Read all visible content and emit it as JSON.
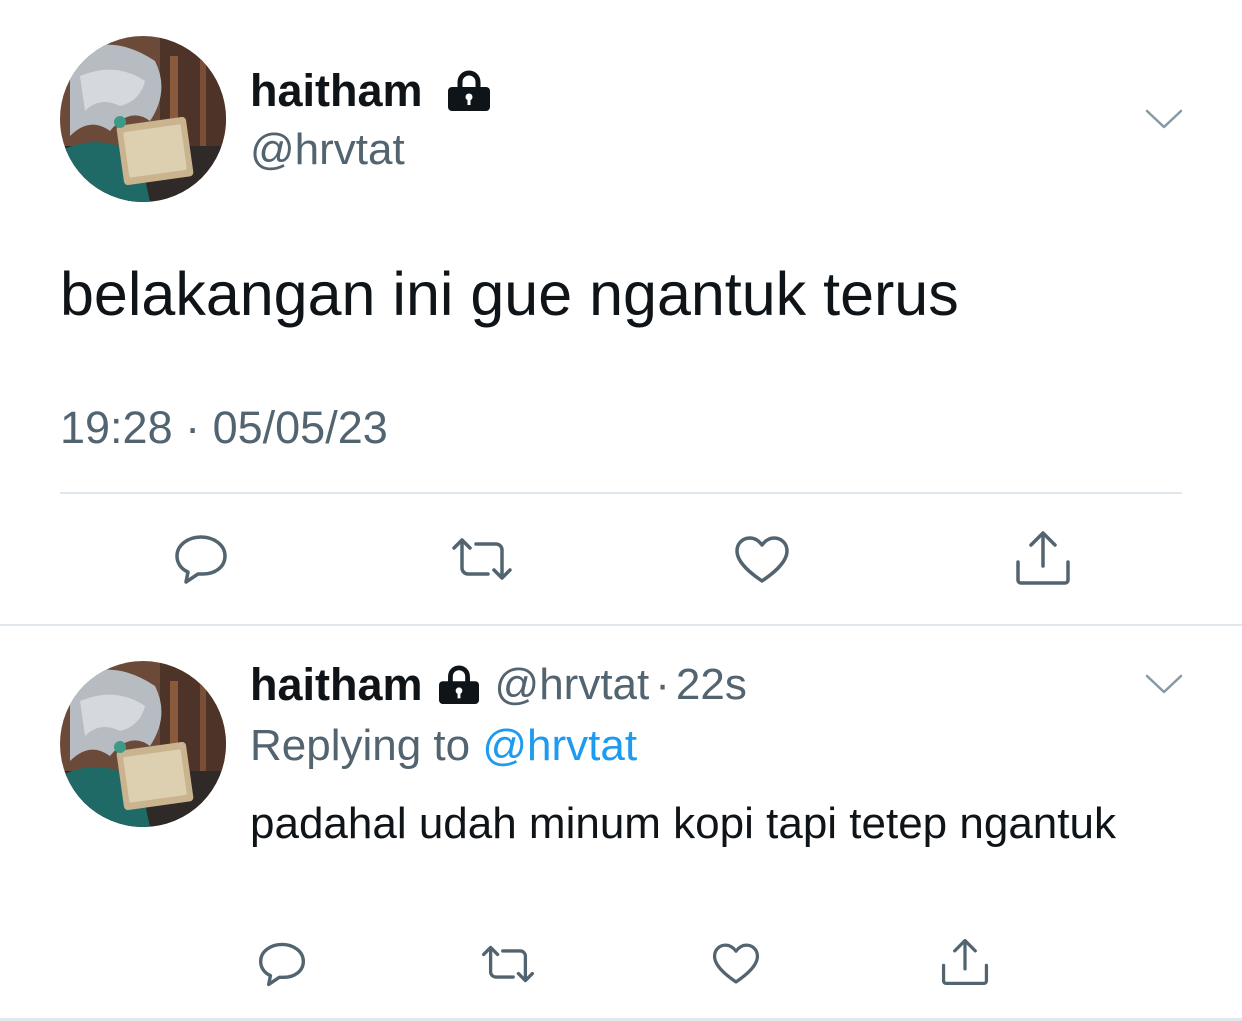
{
  "main_tweet": {
    "display_name": "haitham",
    "handle": "@hrvtat",
    "text": "belakangan ini gue ngantuk terus",
    "timestamp": "19:28 · 05/05/23",
    "protected_icon": "lock-icon",
    "menu_icon": "chevron-down-icon",
    "actions": [
      "reply-icon",
      "retweet-icon",
      "like-icon",
      "share-icon"
    ]
  },
  "reply_tweet": {
    "display_name": "haitham",
    "handle": "@hrvtat",
    "separator": "·",
    "time_ago": "22s",
    "replying_prefix": "Replying to",
    "replying_mention": "@hrvtat",
    "text": "padahal udah minum kopi tapi tetep ngantuk",
    "protected_icon": "lock-icon",
    "menu_icon": "chevron-down-icon",
    "actions": [
      "reply-icon",
      "retweet-icon",
      "like-icon",
      "share-icon"
    ]
  },
  "colors": {
    "primary_text": "#0f1419",
    "secondary_text": "#536471",
    "mention_link": "#1d9bf0",
    "divider": "#e1e8ed"
  }
}
